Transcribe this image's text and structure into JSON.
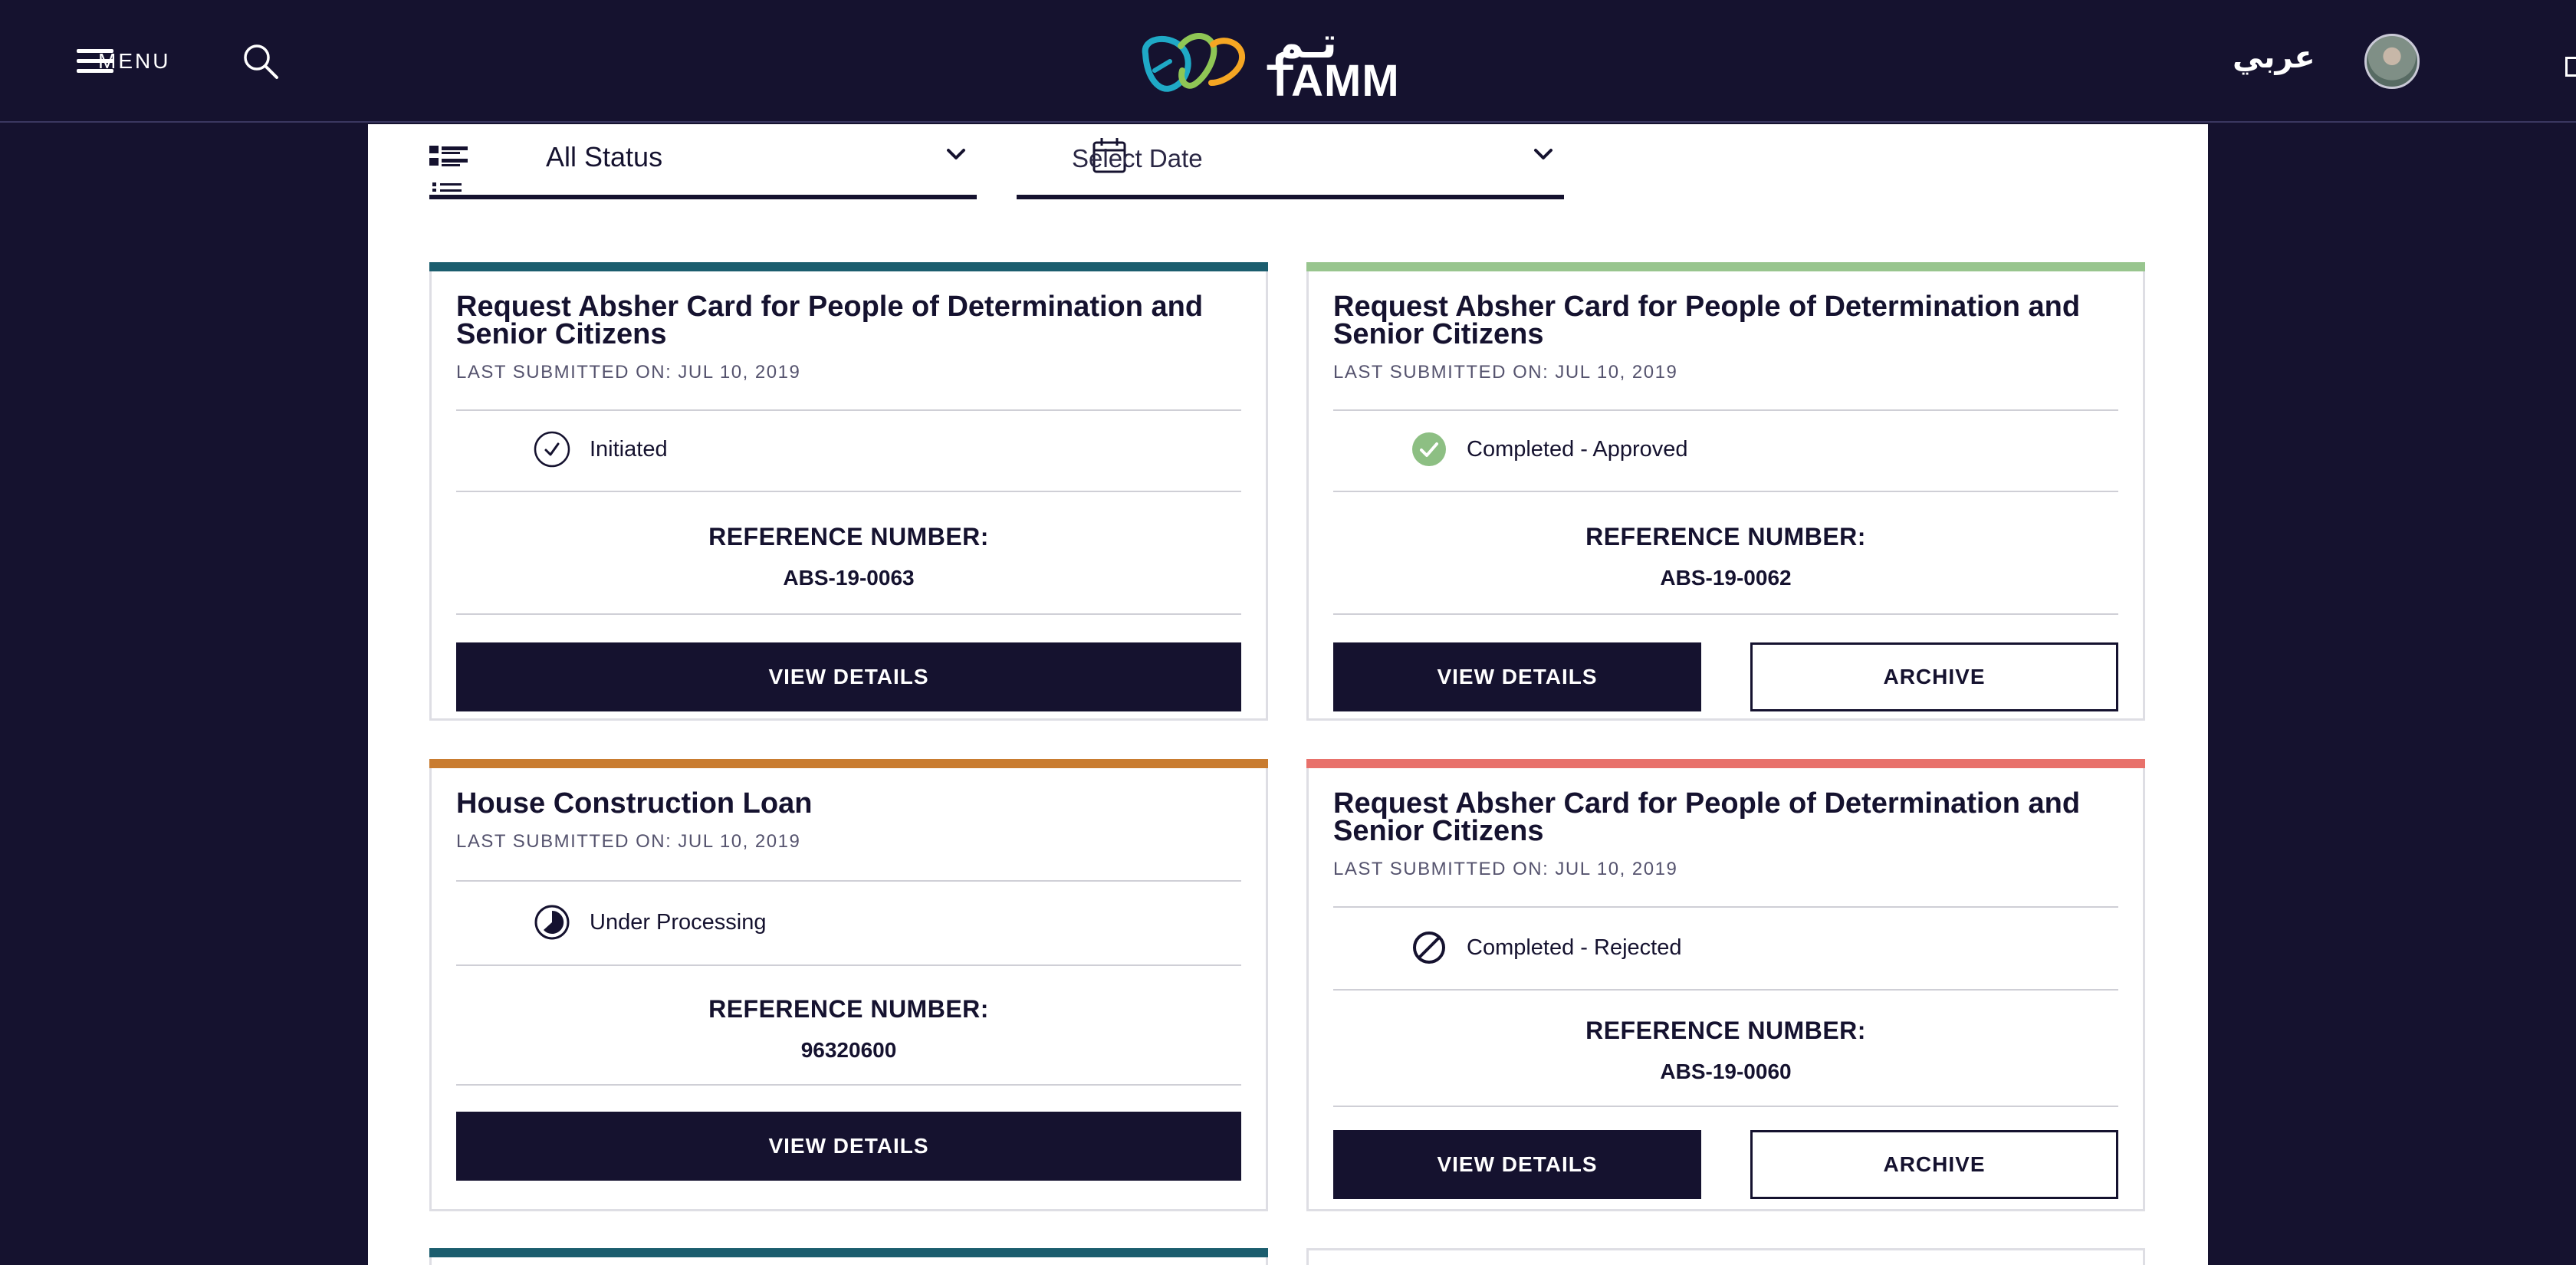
{
  "header": {
    "menu_label": "MENU",
    "logo_en": "TAMM",
    "logo_ar": "تـم",
    "language_toggle": "عربي",
    "search_icon": "search-icon",
    "avatar_icon": "user-avatar"
  },
  "filters": {
    "status": {
      "label": "All Status",
      "icon": "list-icon"
    },
    "date": {
      "label": "Select Date",
      "icon": "calendar-icon"
    }
  },
  "labels": {
    "reference_number": "REFERENCE NUMBER:",
    "view_details": "VIEW DETAILS",
    "archive": "ARCHIVE"
  },
  "colors": {
    "navy": "#15122f",
    "teal_bar": "#1b5d6e",
    "green_bar": "#98c58e",
    "orange_bar": "#c97c30",
    "red_bar": "#e8716b",
    "approved_green": "#8dbf83"
  },
  "cards": [
    {
      "title": "Request Absher Card for People of Determination and Senior Citizens",
      "submitted": "LAST SUBMITTED ON: JUL 10, 2019",
      "status": "Initiated",
      "status_icon": "check-circle-outline-icon",
      "reference": "ABS-19-0063",
      "bar_color": "#1b5d6e"
    },
    {
      "title": "Request Absher Card for People of Determination and Senior Citizens",
      "submitted": "LAST SUBMITTED ON: JUL 10, 2019",
      "status": "Completed - Approved",
      "status_icon": "check-circle-filled-icon",
      "reference": "ABS-19-0062",
      "bar_color": "#98c58e"
    },
    {
      "title": "House Construction Loan",
      "submitted": "LAST SUBMITTED ON: JUL 10, 2019",
      "status": "Under Processing",
      "status_icon": "progress-circle-icon",
      "reference": "96320600",
      "bar_color": "#c97c30"
    },
    {
      "title": "Request Absher Card for People of Determination and Senior Citizens",
      "submitted": "LAST SUBMITTED ON: JUL 10, 2019",
      "status": "Completed - Rejected",
      "status_icon": "blocked-circle-icon",
      "reference": "ABS-19-0060",
      "bar_color": "#e8716b"
    }
  ]
}
